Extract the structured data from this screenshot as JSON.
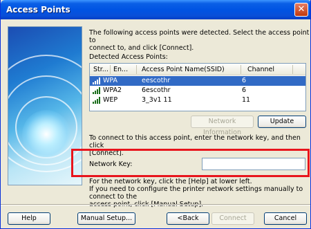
{
  "window": {
    "title": "Access Points",
    "close_glyph": "✕"
  },
  "intro_lines": [
    "The following access points were detected. Select the access point to",
    "connect to, and click [Connect]."
  ],
  "detected_label": "Detected Access Points:",
  "list": {
    "headers": [
      "Str...",
      "En...",
      "Access Point Name(SSID)",
      "Channel"
    ],
    "rows": [
      {
        "signal_icon": "signal-strength-icon",
        "encryption": "WPA",
        "ssid": "eescothr",
        "channel": "6",
        "selected": true
      },
      {
        "signal_icon": "signal-strength-icon",
        "encryption": "WPA2",
        "ssid": "6escothr",
        "channel": "6",
        "selected": false
      },
      {
        "signal_icon": "signal-strength-icon",
        "encryption": "WEP",
        "ssid": "3_3v1 11",
        "channel": "11",
        "selected": false
      }
    ]
  },
  "buttons": {
    "network_information": "Network Information",
    "update": "Update",
    "help": "Help",
    "manual_setup": "Manual Setup...",
    "back": "<Back",
    "connect": "Connect",
    "cancel": "Cancel"
  },
  "instruction_lines": [
    "To connect to this access point, enter the network key, and then click",
    "[Connect]."
  ],
  "network_key": {
    "label": "Network Key:",
    "value": ""
  },
  "help_lines": [
    "For the network key, click the [Help] at lower left.",
    "If you need to configure the printer network settings manually to connect to the",
    "access point, click [Manual Setup]."
  ],
  "colors": {
    "title_bar": "#0054e3",
    "selection": "#316ac5",
    "highlight_box": "#e8141c",
    "dialog_bg": "#ece9d8"
  }
}
